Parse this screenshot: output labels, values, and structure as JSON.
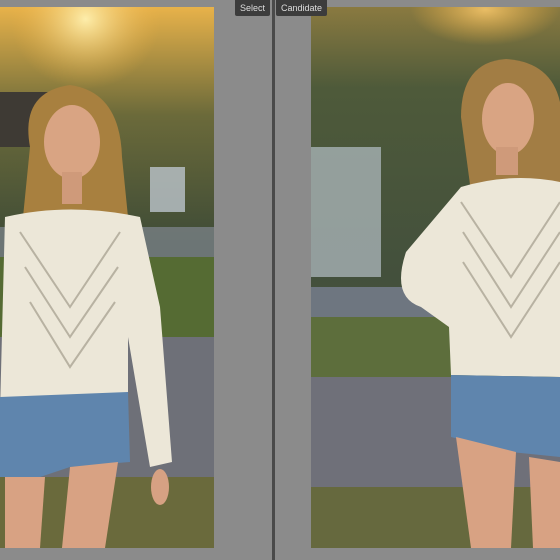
{
  "compare_view": {
    "left_pane": {
      "label": "Select",
      "photo_icon": "portrait-photo"
    },
    "right_pane": {
      "label": "Candidate",
      "photo_icon": "portrait-photo"
    }
  },
  "colors": {
    "background": "#8b8b8b",
    "divider": "#4a4a4a",
    "label_bg": "#3c3c3c",
    "label_text": "#dedede"
  }
}
